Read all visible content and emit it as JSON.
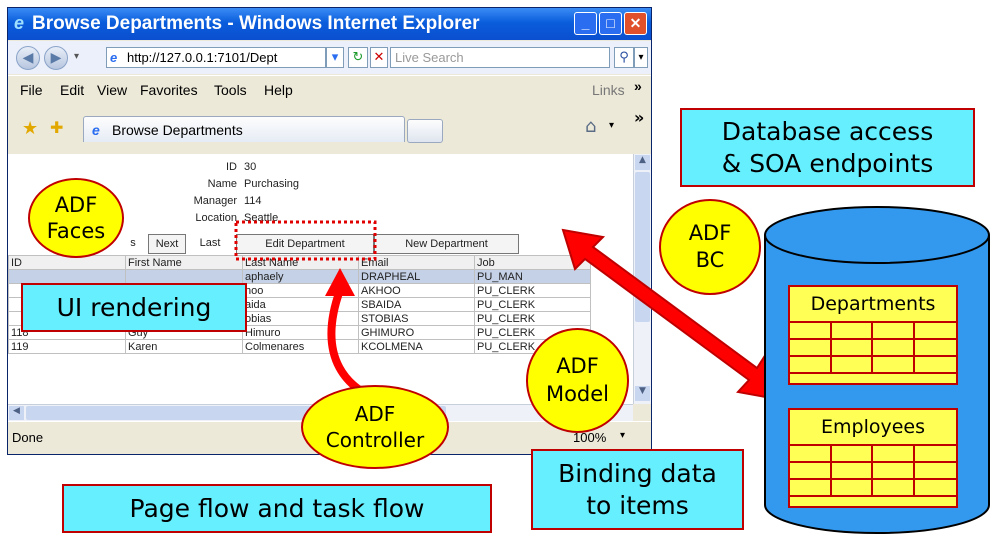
{
  "window": {
    "title": "Browse Departments - Windows Internet Explorer",
    "address": "http://127.0.0.1:7101/Dept",
    "search_placeholder": "Live Search",
    "links_label": "Links",
    "menu": [
      "File",
      "Edit",
      "View",
      "Favorites",
      "Tools",
      "Help"
    ],
    "tab_label": "Browse Departments",
    "status": "Done",
    "zoom": "100%"
  },
  "form": {
    "labels": [
      "ID",
      "Name",
      "Manager",
      "Location"
    ],
    "values": [
      "30",
      "Purchasing",
      "114",
      "Seattle"
    ]
  },
  "nav_buttons": [
    "s",
    "Next",
    "Last",
    "Edit Department",
    "New Department"
  ],
  "table": {
    "headers": [
      "ID",
      "First Name",
      "Last Name",
      "Email",
      "Job"
    ],
    "rows": [
      [
        "",
        "",
        "aphaely",
        "DRAPHEAL",
        "PU_MAN"
      ],
      [
        "",
        "",
        "hoo",
        "AKHOO",
        "PU_CLERK"
      ],
      [
        "",
        "",
        "aida",
        "SBAIDA",
        "PU_CLERK"
      ],
      [
        "",
        "",
        "obias",
        "STOBIAS",
        "PU_CLERK"
      ],
      [
        "118",
        "Guy",
        "Himuro",
        "GHIMURO",
        "PU_CLERK"
      ],
      [
        "119",
        "Karen",
        "Colmenares",
        "KCOLMENA",
        "PU_CLERK"
      ]
    ]
  },
  "overlays": {
    "adf_faces": [
      "ADF",
      "Faces"
    ],
    "ui_rendering": "UI rendering",
    "adf_controller": [
      "ADF",
      "Controller"
    ],
    "adf_model": [
      "ADF",
      "Model"
    ],
    "adf_bc": [
      "ADF",
      "BC"
    ],
    "page_flow": "Page flow and task flow",
    "binding_data": [
      "Binding data",
      "to items"
    ],
    "database_access": [
      "Database access",
      "& SOA endpoints"
    ],
    "departments": "Departments",
    "employees": "Employees"
  },
  "colors": {
    "bubble_fill": "#ffff00",
    "callout_fill": "#66f0ff",
    "outline": "#c00000",
    "arrow": "#ff0000",
    "cylinder": "#3399ee"
  },
  "icons": [
    "ie-logo-icon",
    "back-icon",
    "forward-icon",
    "refresh-icon",
    "stop-icon",
    "search-icon",
    "favorites-star-icon",
    "add-favorites-icon",
    "home-icon"
  ]
}
